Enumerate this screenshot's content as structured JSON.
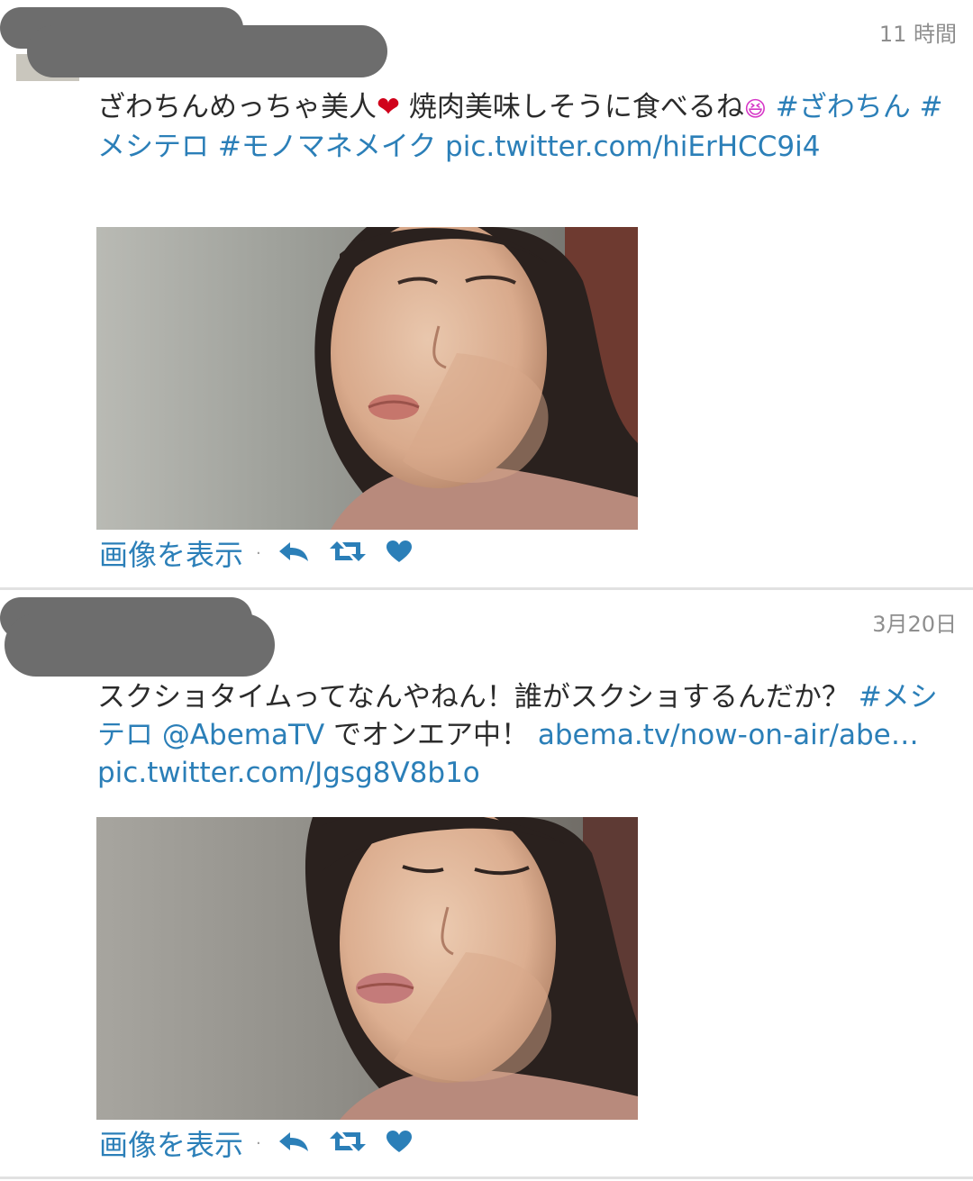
{
  "tweets": [
    {
      "timestamp": "11 時間",
      "text_parts": [
        {
          "t": "ざわちんめっちゃ美人",
          "c": "text"
        },
        {
          "t": "❤",
          "c": "emoji-heart"
        },
        {
          "t": " 焼肉美味しそうに食べるね",
          "c": "text"
        },
        {
          "t": "😆",
          "c": "emoji-face"
        },
        {
          "t": " #ざわちん #メシテロ #モノマネメイク pic.twitter.com/hiErHCC9i4",
          "c": "link"
        }
      ],
      "action_label": "画像を表示",
      "dot": "·"
    },
    {
      "timestamp": "3月20日",
      "text_parts": [
        {
          "t": "スクショタイムってなんやねん！誰がスクショするんだか？ ",
          "c": "text"
        },
        {
          "t": "#メシテロ @AbemaTV",
          "c": "link"
        },
        {
          "t": " でオンエア中！ ",
          "c": "text"
        },
        {
          "t": "abema.tv/now-on-air/abe… pic.twitter.com/Jgsg8V8b1o",
          "c": "link"
        }
      ],
      "action_label": "画像を表示",
      "dot": "·"
    }
  ],
  "icons": [
    "reply-icon",
    "retweet-icon",
    "like-icon"
  ],
  "colors": {
    "link": "#2b7fb8",
    "timestamp": "#8e8e8e",
    "divider": "#e1e1e1",
    "redaction": "#6d6d6d"
  }
}
